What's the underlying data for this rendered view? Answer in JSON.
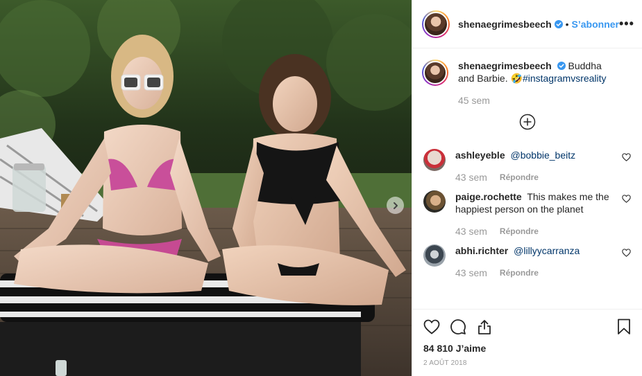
{
  "post": {
    "author": "shenaegrimesbeech",
    "follow_label": "S’abonner",
    "separator": "•",
    "more_label": "•••"
  },
  "caption": {
    "username": "shenaegrimesbeech",
    "text": "Buddha and Barbie.",
    "emoji": "🤣",
    "hashtag": "#instagramvsreality",
    "time": "45 sem"
  },
  "comments": [
    {
      "username": "ashleyeble",
      "text": "",
      "mention": "@bobbie_beitz",
      "time": "43 sem",
      "reply": "Répondre"
    },
    {
      "username": "paige.rochette",
      "text": "This makes me the happiest person on the planet",
      "mention": "",
      "time": "43 sem",
      "reply": "Répondre"
    },
    {
      "username": "abhi.richter",
      "text": "",
      "mention": "@lillyycarranza",
      "time": "43 sem",
      "reply": "Répondre"
    }
  ],
  "footer": {
    "likes": "84 810 J’aime",
    "date": "2 AOÛT 2018"
  },
  "colors": {
    "link_blue": "#3897f0",
    "verified_blue": "#3897f0",
    "muted": "#999999",
    "text": "#262626"
  },
  "icons": [
    "verified-badge-icon",
    "more-options-icon",
    "load-more-plus-icon",
    "heart-icon",
    "comment-icon",
    "share-icon",
    "bookmark-icon",
    "next-arrow-icon"
  ]
}
